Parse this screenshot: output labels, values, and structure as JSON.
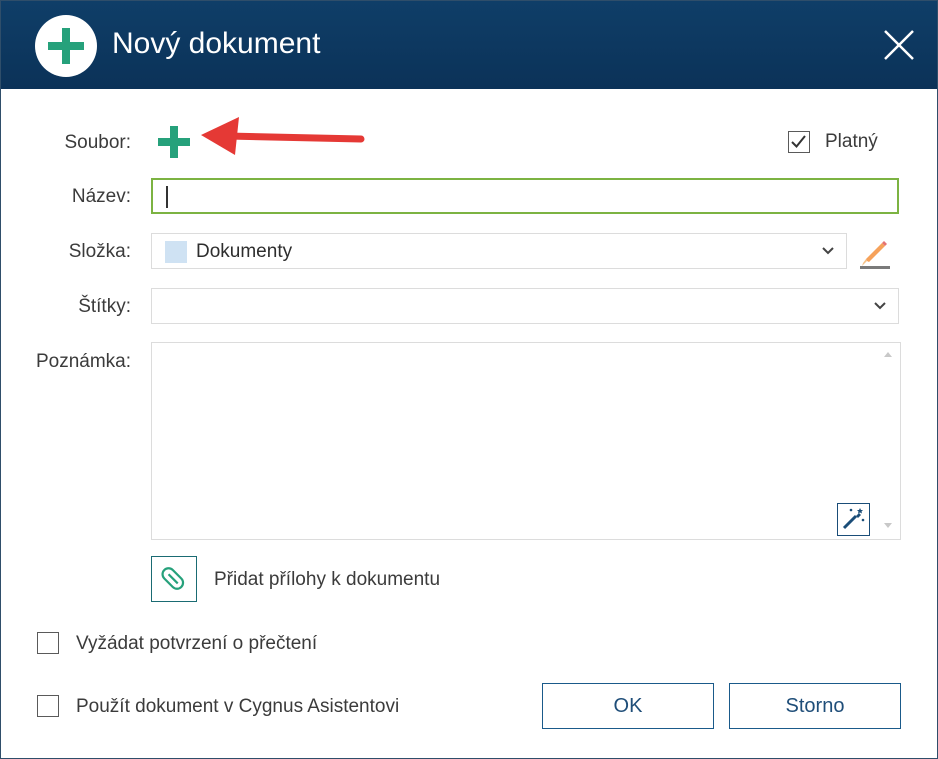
{
  "dialog": {
    "title": "Nový dokument"
  },
  "form": {
    "file_label": "Soubor:",
    "valid_label": "Platný",
    "valid_checked": true,
    "name_label": "Název:",
    "name_value": "",
    "folder_label": "Složka:",
    "folder_value": "Dokumenty",
    "tags_label": "Štítky:",
    "tags_value": "",
    "note_label": "Poznámka:",
    "note_value": "",
    "attach_label": "Přidat přílohy k dokumentu",
    "read_receipt_label": "Vyžádat potvrzení o přečtení",
    "read_receipt_checked": false,
    "assistant_label": "Použít dokument v Cygnus Asistentovi",
    "assistant_checked": false
  },
  "buttons": {
    "ok": "OK",
    "cancel": "Storno"
  },
  "colors": {
    "titlebar": "#0f3e68",
    "accent_green": "#26a17b",
    "focus_border": "#7cb342",
    "annotation_arrow": "#e53935",
    "button_border": "#1a5a8a"
  },
  "icons": {
    "title": "plus-circle-icon",
    "close": "close-icon",
    "add_file": "plus-icon",
    "folder_dropdown": "chevron-down-icon",
    "tags_dropdown": "chevron-down-icon",
    "edit_folder": "pencil-icon",
    "magic": "magic-wand-icon",
    "attach": "paperclip-icon"
  }
}
